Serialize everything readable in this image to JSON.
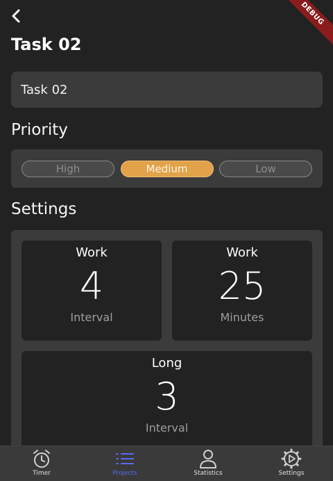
{
  "header": {
    "title": "Task 02",
    "debug_banner": "DEBUG"
  },
  "task_name": {
    "value": "Task 02"
  },
  "priority": {
    "heading": "Priority",
    "options": [
      {
        "label": "High",
        "selected": false
      },
      {
        "label": "Medium",
        "selected": true
      },
      {
        "label": "Low",
        "selected": false
      }
    ],
    "selected_color": "#e2a24a"
  },
  "settings": {
    "heading": "Settings",
    "tiles": [
      {
        "title": "Work",
        "value": "4",
        "unit": "Interval"
      },
      {
        "title": "Work",
        "value": "25",
        "unit": "Minutes"
      },
      {
        "title": "Long",
        "value": "3",
        "unit": "Interval"
      }
    ]
  },
  "bottom_nav": {
    "active_color": "#5b6bf0",
    "items": [
      {
        "label": "Timer",
        "icon": "alarm-clock-icon",
        "active": false
      },
      {
        "label": "Projects",
        "icon": "list-icon",
        "active": true
      },
      {
        "label": "Statistics",
        "icon": "person-icon",
        "active": false
      },
      {
        "label": "Settings",
        "icon": "gear-icon",
        "active": false
      }
    ]
  }
}
